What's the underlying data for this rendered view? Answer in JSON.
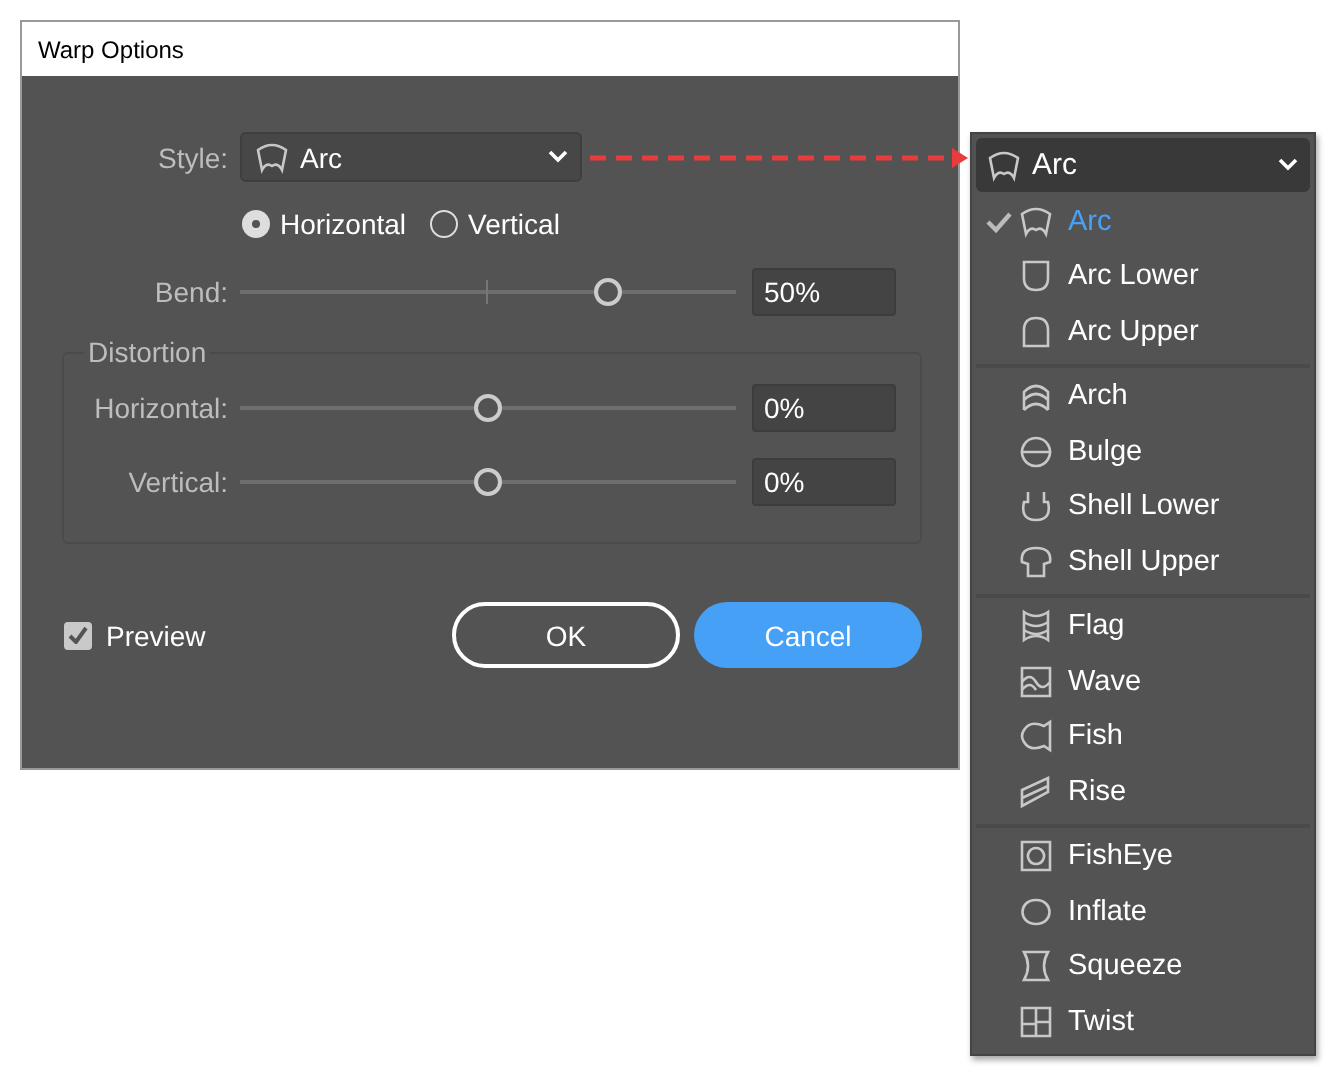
{
  "dialog": {
    "title": "Warp Options",
    "style": {
      "label": "Style:",
      "value": "Arc",
      "kind": "arc"
    },
    "orientation": [
      {
        "label": "Horizontal",
        "selected": true
      },
      {
        "label": "Vertical",
        "selected": false
      }
    ],
    "bend": {
      "label": "Bend:",
      "level": 0.74,
      "value": "50%"
    },
    "distortion": {
      "title": "Distortion",
      "sliders": [
        {
          "label": "Horizontal:",
          "level": 0.5,
          "value": "0%"
        },
        {
          "label": "Vertical:",
          "level": 0.5,
          "value": "0%"
        }
      ]
    },
    "preview": {
      "label": "Preview",
      "checked": true
    },
    "buttons": [
      {
        "label": "OK",
        "kind": "outline"
      },
      {
        "label": "Cancel",
        "kind": "primary"
      }
    ]
  },
  "style_menu": {
    "value": "Arc",
    "kind": "arc",
    "groups": [
      [
        {
          "label": "Arc",
          "kind": "arc",
          "selected": true
        },
        {
          "label": "Arc Lower",
          "kind": "arc-lower",
          "selected": false
        },
        {
          "label": "Arc Upper",
          "kind": "arc-upper",
          "selected": false
        }
      ],
      [
        {
          "label": "Arch",
          "kind": "arch",
          "selected": false
        },
        {
          "label": "Bulge",
          "kind": "bulge",
          "selected": false
        },
        {
          "label": "Shell Lower",
          "kind": "shell-lower",
          "selected": false
        },
        {
          "label": "Shell Upper",
          "kind": "shell-upper",
          "selected": false
        }
      ],
      [
        {
          "label": "Flag",
          "kind": "flag",
          "selected": false
        },
        {
          "label": "Wave",
          "kind": "wave",
          "selected": false
        },
        {
          "label": "Fish",
          "kind": "fish",
          "selected": false
        },
        {
          "label": "Rise",
          "kind": "rise",
          "selected": false
        }
      ],
      [
        {
          "label": "FishEye",
          "kind": "fisheye",
          "selected": false
        },
        {
          "label": "Inflate",
          "kind": "inflate",
          "selected": false
        },
        {
          "label": "Squeeze",
          "kind": "squeeze",
          "selected": false
        },
        {
          "label": "Twist",
          "kind": "twist",
          "selected": false
        }
      ]
    ]
  }
}
